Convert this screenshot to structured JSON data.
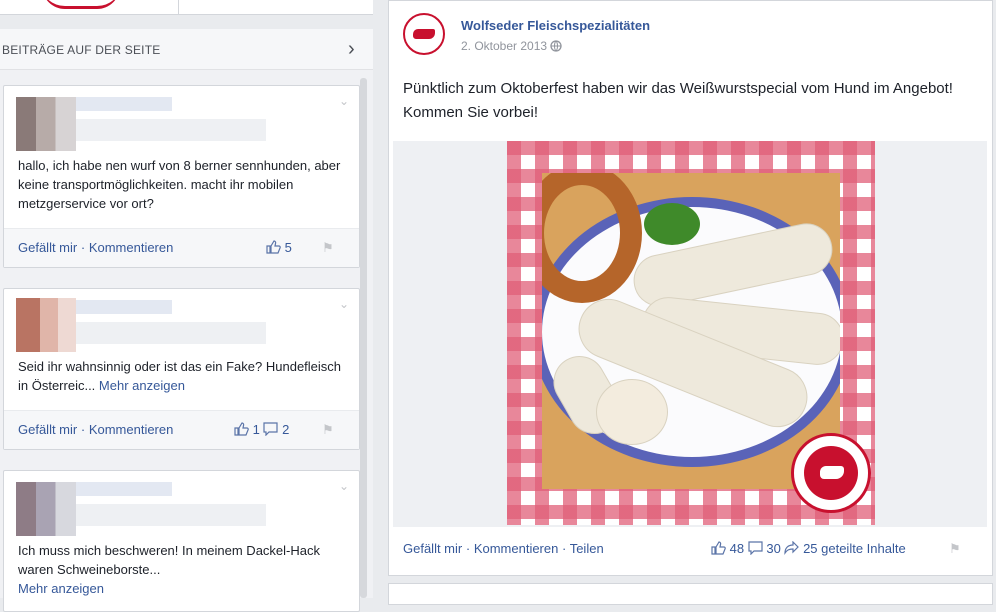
{
  "sidebar": {
    "section_title": "BEITRÄGE AUF DER SEITE",
    "posts": [
      {
        "text": "hallo, ich habe nen wurf von 8 berner sennhunden, aber keine transportmöglichkeiten. macht ihr mobilen metzgerservice vor ort?",
        "like_label": "Gefällt mir",
        "comment_label": "Kommentieren",
        "likes": "5"
      },
      {
        "text": "Seid ihr wahnsinnig oder ist das ein Fake? Hundefleisch in Österreic...",
        "more_label": "Mehr anzeigen",
        "like_label": "Gefällt mir",
        "comment_label": "Kommentieren",
        "likes": "1",
        "comments": "2"
      },
      {
        "text": "Ich muss mich beschweren! In meinem Dackel-Hack waren Schweineborste...",
        "more_label": "Mehr anzeigen"
      }
    ]
  },
  "post": {
    "page_name": "Wolfseder Fleischspezialitäten",
    "date": "2. Oktober 2013",
    "text": "Pünktlich zum Oktoberfest haben wir das Weißwurstspecial vom Hund im Angebot! Kommen Sie vorbei!",
    "like_label": "Gefällt mir",
    "comment_label": "Kommentieren",
    "share_label": "Teilen",
    "likes": "48",
    "comments": "30",
    "shares": "25 geteilte Inhalte"
  },
  "icons": {
    "like": "thumbs-up-icon",
    "comment": "comment-icon",
    "share": "share-icon",
    "flag": "flag-icon",
    "globe": "globe-icon",
    "chevron": "chevron-right-icon",
    "caret": "chevron-down-icon"
  },
  "colors": {
    "link": "#365899",
    "brand_red": "#c8102e",
    "background": "#e9ebee"
  }
}
